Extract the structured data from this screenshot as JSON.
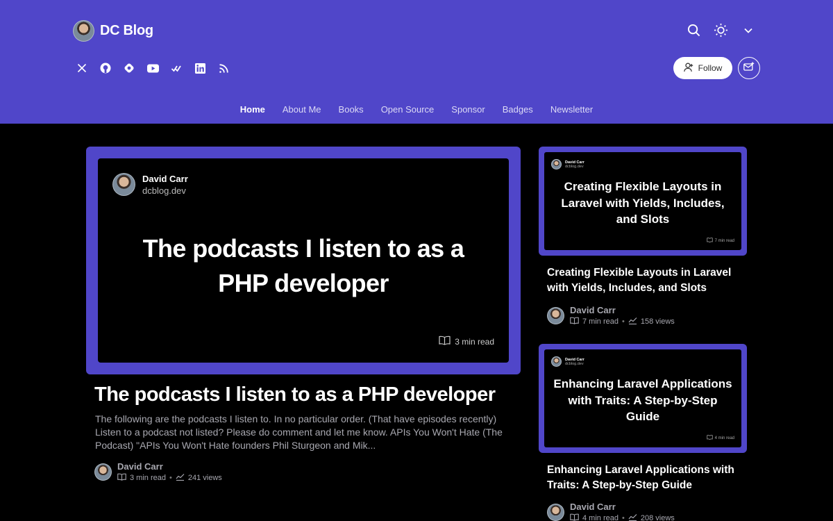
{
  "header": {
    "brand_name": "DC Blog",
    "follow_label": "Follow",
    "socials": [
      "x-icon",
      "github-icon",
      "hashnode-icon",
      "youtube-icon",
      "dev-icon",
      "linkedin-icon",
      "rss-icon"
    ],
    "nav": [
      {
        "label": "Home",
        "active": true
      },
      {
        "label": "About Me"
      },
      {
        "label": "Books"
      },
      {
        "label": "Open Source"
      },
      {
        "label": "Sponsor"
      },
      {
        "label": "Badges"
      },
      {
        "label": "Newsletter"
      }
    ]
  },
  "featured": {
    "cover_author": "David Carr",
    "cover_site": "dcblog.dev",
    "cover_title": "The podcasts I listen to as a PHP developer",
    "cover_read": "3 min read",
    "title": "The podcasts I listen to as a PHP developer",
    "excerpt": "The following are the podcasts I listen to. In no particular order. (That have episodes recently) Listen to a podcast not listed? Please do comment and let me know. APIs You Won't Hate (The Podcast) \"APIs You Won't Hate founders Phil Sturgeon and Mik...",
    "author": "David Carr",
    "read": "3 min read",
    "views": "241 views"
  },
  "posts": [
    {
      "cover_author": "David Carr",
      "cover_site": "dcblog.dev",
      "cover_title": "Creating Flexible Layouts in Laravel with Yields, Includes, and Slots",
      "cover_read": "7 min read",
      "title": "Creating Flexible Layouts in Laravel with Yields, Includes, and Slots",
      "author": "David Carr",
      "read": "7 min read",
      "views": "158 views"
    },
    {
      "cover_author": "David Carr",
      "cover_site": "dcblog.dev",
      "cover_title": "Enhancing Laravel Applications with Traits: A Step-by-Step Guide",
      "cover_read": "4 min read",
      "title": "Enhancing Laravel Applications with Traits: A Step-by-Step Guide",
      "author": "David Carr",
      "read": "4 min read",
      "views": "208 views"
    }
  ],
  "colors": {
    "brand": "#5046c9",
    "background": "#000000",
    "muted_text": "#a8a8b0"
  }
}
